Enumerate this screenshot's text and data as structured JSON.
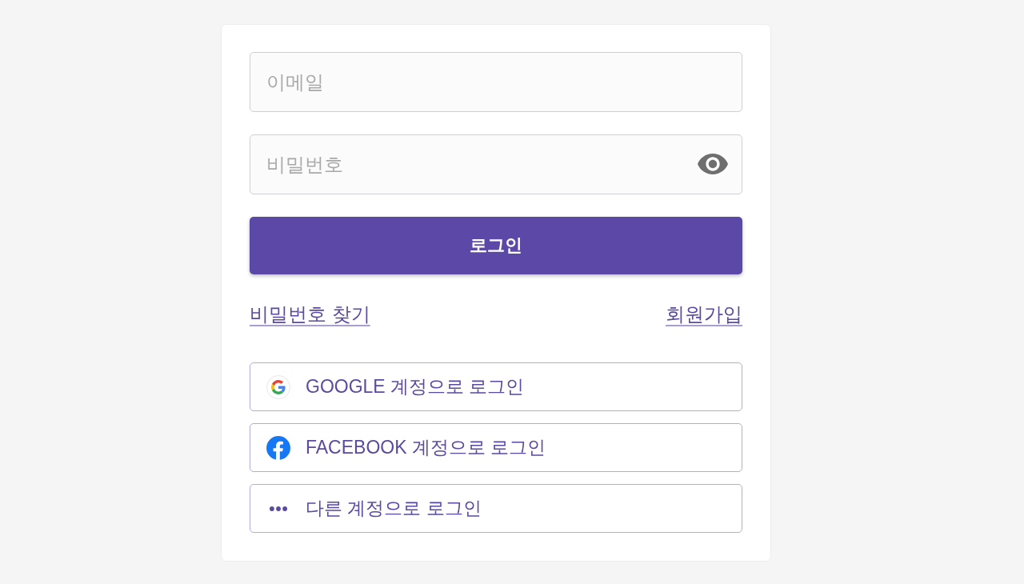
{
  "fields": [
    {
      "kind": "email",
      "placeholder": "이메일"
    },
    {
      "kind": "password",
      "placeholder": "비밀번호"
    }
  ],
  "login_button": {
    "label": "로그인"
  },
  "links": [
    {
      "label": "비밀번호 찾기"
    },
    {
      "label": "회원가입"
    }
  ],
  "social_logins": [
    {
      "kind": "google",
      "label": "GOOGLE 계정으로 로그인"
    },
    {
      "kind": "facebook",
      "label": "FACEBOOK 계정으로 로그인"
    },
    {
      "kind": "other",
      "label": "다른 계정으로 로그인"
    }
  ]
}
